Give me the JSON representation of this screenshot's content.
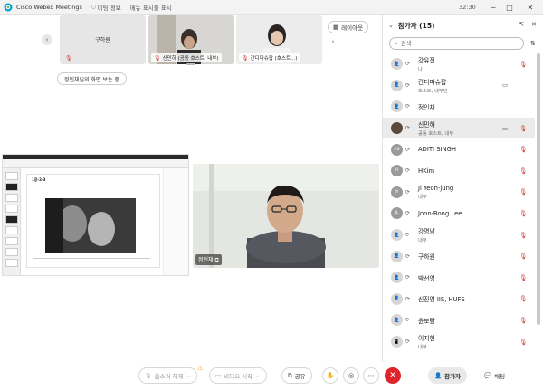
{
  "titlebar": {
    "app_title": "Cisco Webex Meetings",
    "menu_meeting_info": "미팅 정보",
    "menu_show_menu": "메뉴 표시줄 표시",
    "time": "32:30",
    "minimize": "─",
    "maximize": "□",
    "close": "✕"
  },
  "stage": {
    "layout_button": "레이아웃",
    "viewing_label": "정인채님의 화면 보는 중",
    "thumbnails": [
      {
        "name": "구하원",
        "centered": true
      },
      {
        "name": "신민하 (공동 호스트, 내부)",
        "centered": false
      },
      {
        "name": "간디마슈팝 (호스트...)",
        "centered": false
      }
    ],
    "shared_doc_title": "1장-2-3",
    "speaker_name": "정인채"
  },
  "controls": {
    "mute": "음소거 해제",
    "video": "비디오 시작",
    "share": "공유",
    "participants": "참가자",
    "chat": "채팅"
  },
  "panel": {
    "title": "참가자 (15)",
    "search_placeholder": "검색",
    "participants": [
      {
        "name": "강유진",
        "role": "나",
        "avatar": "person",
        "cam": false,
        "muted": true,
        "active": false
      },
      {
        "name": "간디마슈팝",
        "role": "호스트, 내부인",
        "avatar": "person",
        "cam": true,
        "muted": false,
        "active": false
      },
      {
        "name": "정인채",
        "role": "",
        "avatar": "person",
        "cam": false,
        "muted": false,
        "active": false
      },
      {
        "name": "신민하",
        "role": "공동 호스트, 내부",
        "avatar": "photo",
        "cam": true,
        "muted": true,
        "active": true
      },
      {
        "name": "ADITI SINGH",
        "role": "",
        "avatar": "AS",
        "cam": false,
        "muted": true,
        "active": false
      },
      {
        "name": "HKim",
        "role": "",
        "avatar": "H",
        "cam": false,
        "muted": true,
        "active": false
      },
      {
        "name": "Ji Yeon-jung",
        "role": "내부",
        "avatar": "JY",
        "cam": false,
        "muted": true,
        "active": false
      },
      {
        "name": "Joon-Bong Lee",
        "role": "",
        "avatar": "JL",
        "cam": false,
        "muted": true,
        "active": false
      },
      {
        "name": "강명남",
        "role": "내부",
        "avatar": "person",
        "cam": false,
        "muted": true,
        "active": false
      },
      {
        "name": "구하원",
        "role": "",
        "avatar": "person",
        "cam": false,
        "muted": true,
        "active": false
      },
      {
        "name": "박선영",
        "role": "",
        "avatar": "person",
        "cam": false,
        "muted": true,
        "active": false
      },
      {
        "name": "신진영 IIS, HUFS",
        "role": "",
        "avatar": "person",
        "cam": false,
        "muted": true,
        "active": false
      },
      {
        "name": "윤보람",
        "role": "",
        "avatar": "person",
        "cam": false,
        "muted": true,
        "active": false
      },
      {
        "name": "이지현",
        "role": "내부",
        "avatar": "phone",
        "cam": false,
        "muted": true,
        "active": false
      }
    ]
  }
}
